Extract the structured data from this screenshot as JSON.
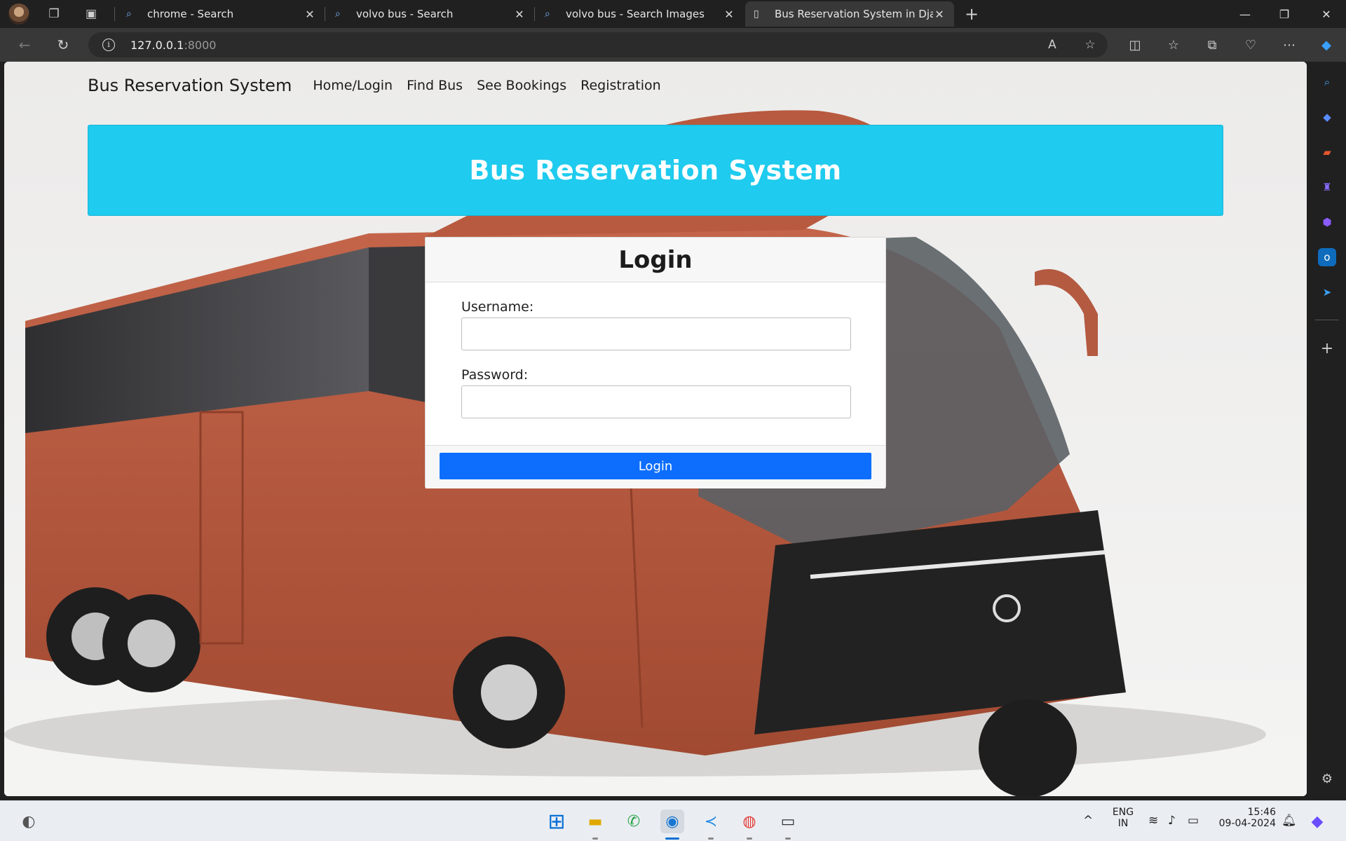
{
  "browser": {
    "tabs": [
      {
        "title": "chrome - Search",
        "icon": "search-icon"
      },
      {
        "title": "volvo bus - Search",
        "icon": "search-icon"
      },
      {
        "title": "volvo bus - Search Images",
        "icon": "search-icon"
      },
      {
        "title": "Bus Reservation System in Djang",
        "icon": "page-icon",
        "active": true
      }
    ],
    "url_host": "127.0.0.1",
    "url_port": ":8000"
  },
  "page": {
    "brand": "Bus Reservation System",
    "nav": [
      "Home/Login",
      "Find Bus",
      "See Bookings",
      "Registration"
    ],
    "hero_title": "Bus Reservation System",
    "login": {
      "title": "Login",
      "username_label": "Username:",
      "username_value": "",
      "password_label": "Password:",
      "password_value": "",
      "submit_label": "Login"
    },
    "colors": {
      "hero": "#1fcbee",
      "button": "#0d6efd",
      "bus": "#b5553a"
    }
  },
  "taskbar": {
    "lang": "ENG",
    "region": "IN",
    "time": "15:46",
    "date": "09-04-2024"
  }
}
